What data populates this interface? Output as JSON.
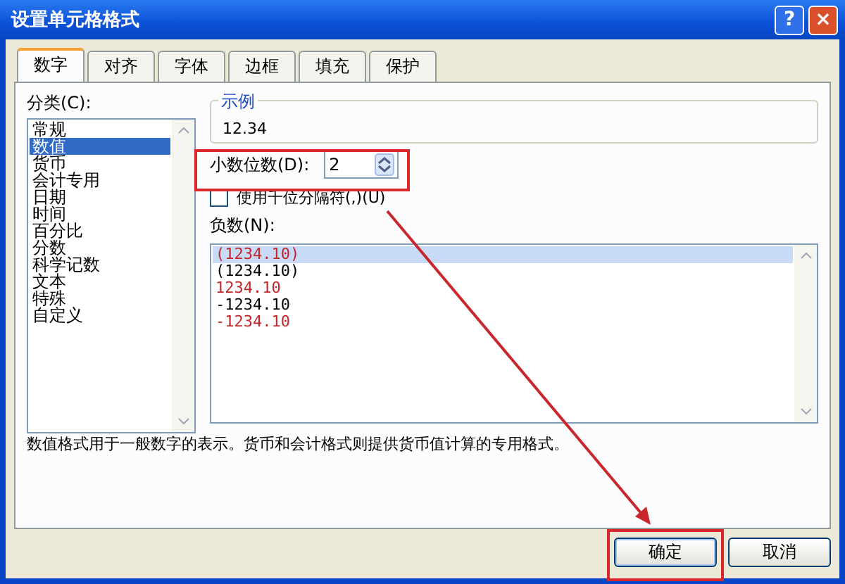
{
  "window": {
    "title": "设置单元格格式",
    "help_button": "?",
    "close_button": "×"
  },
  "tabs": [
    {
      "label": "数字",
      "selected": true
    },
    {
      "label": "对齐",
      "selected": false
    },
    {
      "label": "字体",
      "selected": false
    },
    {
      "label": "边框",
      "selected": false
    },
    {
      "label": "填充",
      "selected": false
    },
    {
      "label": "保护",
      "selected": false
    }
  ],
  "category": {
    "label": "分类(C):",
    "items": [
      {
        "label": "常规",
        "selected": false
      },
      {
        "label": "数值",
        "selected": true
      },
      {
        "label": "货币",
        "selected": false
      },
      {
        "label": "会计专用",
        "selected": false
      },
      {
        "label": "日期",
        "selected": false
      },
      {
        "label": "时间",
        "selected": false
      },
      {
        "label": "百分比",
        "selected": false
      },
      {
        "label": "分数",
        "selected": false
      },
      {
        "label": "科学记数",
        "selected": false
      },
      {
        "label": "文本",
        "selected": false
      },
      {
        "label": "特殊",
        "selected": false
      },
      {
        "label": "自定义",
        "selected": false
      }
    ]
  },
  "sample": {
    "title": "示例",
    "value": "12.34"
  },
  "decimal_places": {
    "label": "小数位数(D):",
    "value": "2"
  },
  "thousands_separator": {
    "label": "使用千位分隔符(,)(U)",
    "checked": false
  },
  "negative_numbers": {
    "label": "负数(N):",
    "items": [
      {
        "label": "(1234.10)",
        "color": "#c0282c",
        "selected": true
      },
      {
        "label": "(1234.10)",
        "color": "#000000",
        "selected": false
      },
      {
        "label": "1234.10",
        "color": "#c0282c",
        "selected": false
      },
      {
        "label": "-1234.10",
        "color": "#000000",
        "selected": false
      },
      {
        "label": "-1234.10",
        "color": "#c0282c",
        "selected": false
      }
    ]
  },
  "description": "数值格式用于一般数字的表示。货币和会计格式则提供货币值计算的专用格式。",
  "buttons": [
    {
      "label": "确定",
      "kind": "default"
    },
    {
      "label": "取消",
      "kind": "normal"
    }
  ]
}
